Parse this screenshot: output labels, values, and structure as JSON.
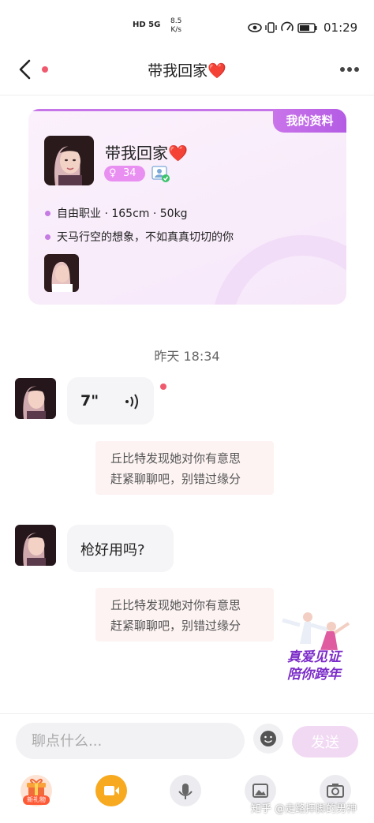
{
  "status_bar": {
    "network": "HD 5G",
    "speed": "8.5\nK/s",
    "time": "01:29"
  },
  "nav": {
    "title": "带我回家❤️",
    "back_icon": "chevron-left-icon",
    "more_icon": "more-dots-icon"
  },
  "profile_card": {
    "tag": "我的资料",
    "name": "带我回家❤️",
    "gender_symbol": "♀",
    "age": "34",
    "details": "自由职业 · 165cm · 50kg",
    "bio": "天马行空的想象，不如真真切切的你"
  },
  "chat": {
    "time_divider": "昨天 18:34",
    "voice_duration": "7\"",
    "system_note_line1": "丘比特发现她对你有意思",
    "system_note_line2": "赶紧聊聊吧，别错过缘分",
    "text_message": "枪好用吗?"
  },
  "promo": {
    "line1": "真爱见证",
    "line2": "陪你跨年"
  },
  "input": {
    "placeholder": "聊点什么...",
    "send_label": "发送"
  },
  "toolbar": {
    "gift_label": "新礼物",
    "watermark": "知乎 @走路摔脚的男神"
  },
  "colors": {
    "accent": "#c974ea",
    "unread": "#f05a6e",
    "video": "#f4a623"
  }
}
